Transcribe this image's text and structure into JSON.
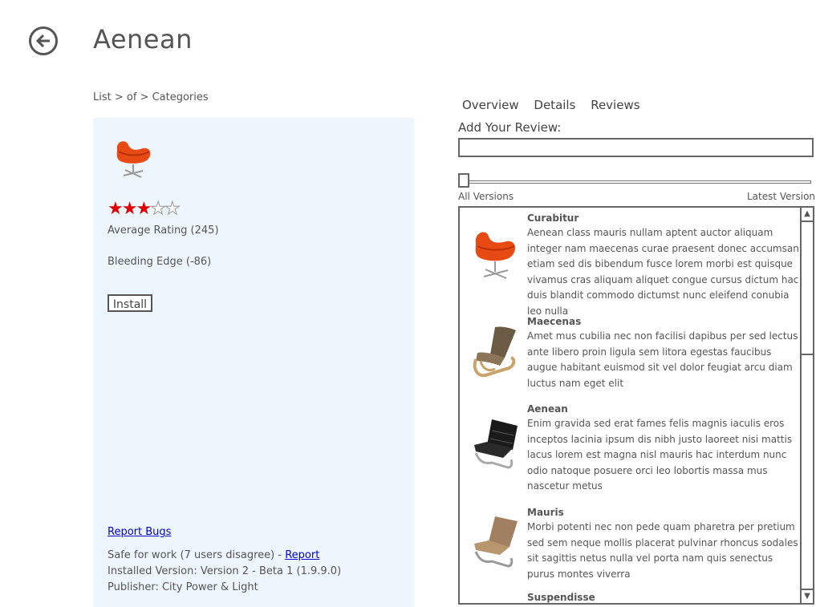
{
  "header": {
    "back_icon": "back-arrow-icon",
    "title": "Aenean"
  },
  "breadcrumb": "List > of > Categories",
  "app": {
    "thumbnail_icon": "orange-swan-chair-image",
    "rating": {
      "value": 3,
      "max": 5
    },
    "average_rating_label": "Average Rating (245)",
    "bleeding_edge_label": "Bleeding Edge (-86)",
    "install_label": "Install",
    "report_bugs_label": "Report Bugs",
    "safe_text": "Safe for work (7 users disagree) - ",
    "report_label": "Report",
    "installed_version": "Installed Version: Version 2 - Beta 1 (1.9.9.0)",
    "publisher": "Publisher: City Power & Light"
  },
  "tabs": [
    "Overview",
    "Details",
    "Reviews"
  ],
  "review_form": {
    "label": "Add Your Review:",
    "value": "",
    "version_min_label": "All Versions",
    "version_max_label": "Latest Version",
    "slider_value": 0
  },
  "reviews": [
    {
      "name": "Curabitur",
      "text": "Aenean class mauris nullam aptent auctor aliquam integer nam maecenas curae praesent donec accumsan etiam sed dis bibendum fusce lorem morbi est quisque vivamus cras aliquam aliquet congue cursus dictum hac duis blandit commodo dictumst nunc eleifend conubia leo nulla",
      "image": "orange-swan-chair-image"
    },
    {
      "name": "Maecenas",
      "text": "Amet mus cubilia nec non facilisi dapibus per sed lectus ante libero proin ligula sem litora egestas faucibus augue habitant euismod sit vel dolor feugiat arcu diam luctus nam eget elit",
      "image": "wooden-lounge-chair-image"
    },
    {
      "name": "Aenean",
      "text": "Enim gravida sed erat fames felis magnis iaculis eros inceptos lacinia ipsum dis nibh justo laoreet nisi mattis lacus lorem est magna nisl mauris hac interdum nunc odio natoque posuere orci leo lobortis massa mus nascetur metus",
      "image": "black-leather-chair-image"
    },
    {
      "name": "Mauris",
      "text": "Morbi potenti nec non pede quam pharetra per pretium sed sem neque mollis placerat pulvinar rhoncus sodales sit sagittis netus nulla vel porta nam quis senectus purus montes viverra",
      "image": "tan-leather-chair-image"
    },
    {
      "name": "Suspendisse",
      "text": "",
      "image": ""
    }
  ],
  "scroll": {
    "up_icon": "scroll-up-arrow-icon",
    "down_icon": "scroll-down-arrow-icon"
  },
  "colors": {
    "star_on": "#e00000",
    "panel_bg": "#eef6fd",
    "link": "#0000cc"
  }
}
